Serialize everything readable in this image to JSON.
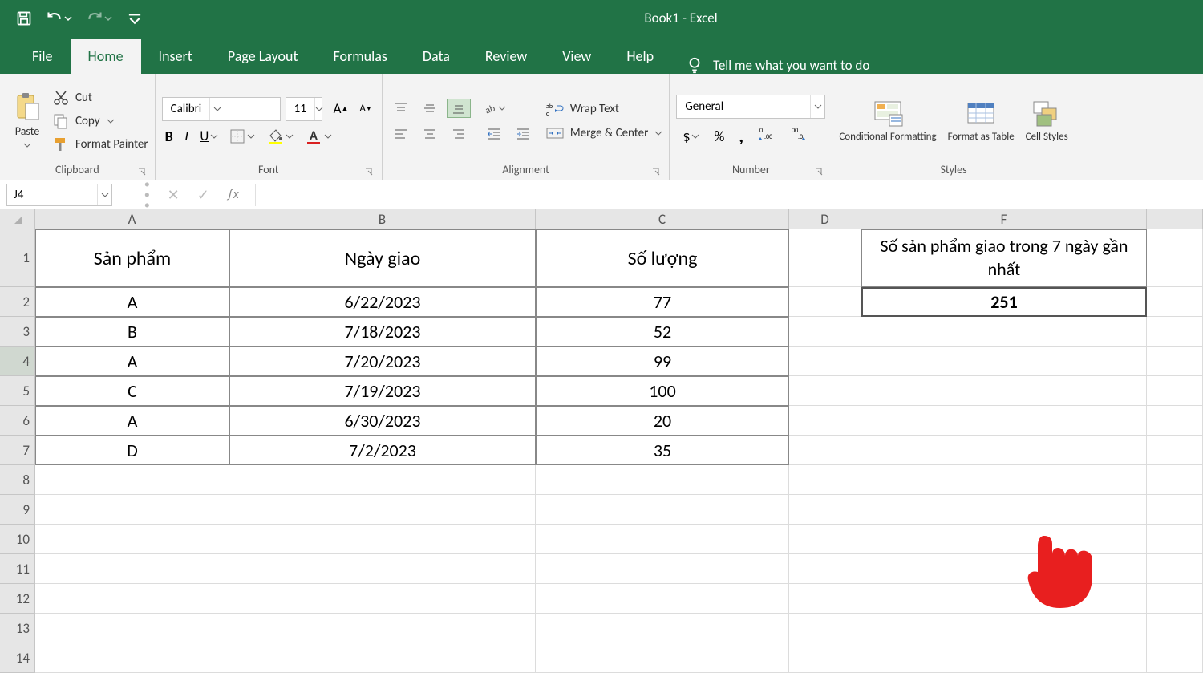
{
  "app": {
    "title": "Book1  -  Excel"
  },
  "qat": {
    "save": "save",
    "undo": "undo",
    "redo": "redo"
  },
  "tabs": [
    "File",
    "Home",
    "Insert",
    "Page Layout",
    "Formulas",
    "Data",
    "Review",
    "View",
    "Help"
  ],
  "active_tab": "Home",
  "tell_me": "Tell me what you want to do",
  "ribbon": {
    "clipboard": {
      "paste": "Paste",
      "cut": "Cut",
      "copy": "Copy",
      "format_painter": "Format Painter",
      "group": "Clipboard"
    },
    "font": {
      "name": "Calibri",
      "size": "11",
      "bold": "B",
      "italic": "I",
      "underline": "U",
      "group": "Font"
    },
    "alignment": {
      "wrap": "Wrap Text",
      "merge": "Merge & Center",
      "group": "Alignment"
    },
    "number": {
      "format": "General",
      "currency": "$",
      "percent": "%",
      "comma": ",",
      "group": "Number"
    },
    "styles": {
      "conditional": "Conditional Formatting",
      "table": "Format as Table",
      "cell": "Cell Styles",
      "group": "Styles"
    }
  },
  "formula_bar": {
    "name_box": "J4",
    "formula": ""
  },
  "sheet": {
    "columns": [
      "A",
      "B",
      "C",
      "D",
      "F"
    ],
    "headers": {
      "A": "Sản phẩm",
      "B": "Ngày giao",
      "C": "Số lượng",
      "F": "Số sản phẩm giao trong 7 ngày gần nhất"
    },
    "rows": [
      {
        "n": "2",
        "A": "A",
        "B": "6/22/2023",
        "C": "77",
        "F": "251"
      },
      {
        "n": "3",
        "A": "B",
        "B": "7/18/2023",
        "C": "52"
      },
      {
        "n": "4",
        "A": "A",
        "B": "7/20/2023",
        "C": "99"
      },
      {
        "n": "5",
        "A": "C",
        "B": "7/19/2023",
        "C": "100"
      },
      {
        "n": "6",
        "A": "A",
        "B": "6/30/2023",
        "C": "20"
      },
      {
        "n": "7",
        "A": "D",
        "B": "7/2/2023",
        "C": "35"
      }
    ],
    "empty_rows": [
      "8",
      "9",
      "10",
      "11",
      "12",
      "13",
      "14"
    ],
    "selected_row": "4"
  }
}
